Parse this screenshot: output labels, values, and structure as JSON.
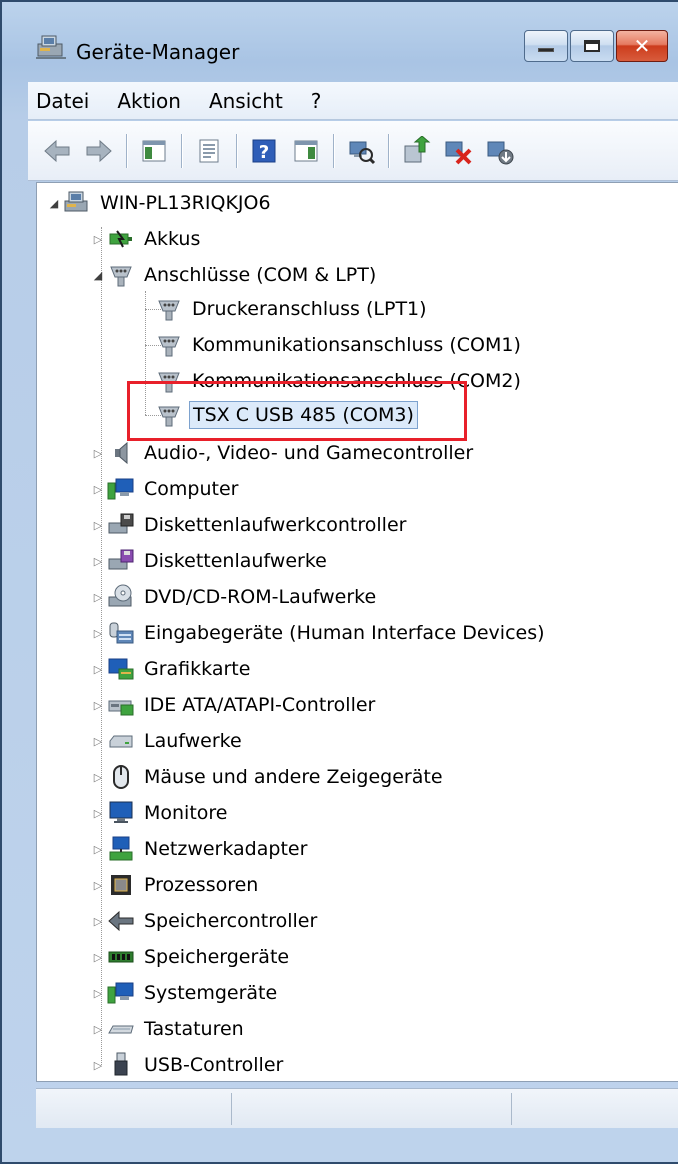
{
  "window": {
    "title": "Geräte-Manager",
    "buttons": {
      "minimize": "minimize",
      "maximize": "maximize",
      "close": "close"
    }
  },
  "menu": {
    "items": [
      "Datei",
      "Aktion",
      "Ansicht",
      "?"
    ]
  },
  "toolbar": {
    "icons": [
      "back-arrow-icon",
      "forward-arrow-icon",
      "show-hide-console-tree-icon",
      "properties-icon",
      "help-icon",
      "show-action-pane-icon",
      "scan-hardware-icon",
      "update-driver-icon",
      "uninstall-device-icon",
      "disable-device-icon"
    ]
  },
  "tree": {
    "root": "WIN-PL13RIQKJO6",
    "categories": [
      {
        "label": "Akkus",
        "icon": "battery-icon"
      },
      {
        "label": "Anschlüsse (COM & LPT)",
        "icon": "port-icon",
        "expanded": true,
        "children": [
          {
            "label": "Druckeranschluss (LPT1)",
            "icon": "port-icon"
          },
          {
            "label": "Kommunikationsanschluss (COM1)",
            "icon": "port-icon"
          },
          {
            "label": "Kommunikationsanschluss (COM2)",
            "icon": "port-icon"
          },
          {
            "label": "TSX C USB 485 (COM3)",
            "icon": "port-icon",
            "highlighted": true
          }
        ]
      },
      {
        "label": "Audio-, Video- und Gamecontroller",
        "icon": "speaker-icon"
      },
      {
        "label": "Computer",
        "icon": "computer-icon"
      },
      {
        "label": "Diskettenlaufwerkcontroller",
        "icon": "floppy-controller-icon"
      },
      {
        "label": "Diskettenlaufwerke",
        "icon": "floppy-drive-icon"
      },
      {
        "label": "DVD/CD-ROM-Laufwerke",
        "icon": "dvd-drive-icon"
      },
      {
        "label": "Eingabegeräte (Human Interface Devices)",
        "icon": "hid-icon"
      },
      {
        "label": "Grafikkarte",
        "icon": "display-adapter-icon"
      },
      {
        "label": "IDE ATA/ATAPI-Controller",
        "icon": "ide-controller-icon"
      },
      {
        "label": "Laufwerke",
        "icon": "disk-drive-icon"
      },
      {
        "label": "Mäuse und andere Zeigegeräte",
        "icon": "mouse-icon"
      },
      {
        "label": "Monitore",
        "icon": "monitor-icon"
      },
      {
        "label": "Netzwerkadapter",
        "icon": "network-adapter-icon"
      },
      {
        "label": "Prozessoren",
        "icon": "processor-icon"
      },
      {
        "label": "Speichercontroller",
        "icon": "storage-controller-icon"
      },
      {
        "label": "Speichergeräte",
        "icon": "memory-icon"
      },
      {
        "label": "Systemgeräte",
        "icon": "system-device-icon"
      },
      {
        "label": "Tastaturen",
        "icon": "keyboard-icon"
      },
      {
        "label": "USB-Controller",
        "icon": "usb-icon"
      }
    ]
  },
  "colors": {
    "highlight_box": "#e8202a",
    "close_button": "#cc3c1d",
    "title_bar": "#a9c4e4"
  }
}
